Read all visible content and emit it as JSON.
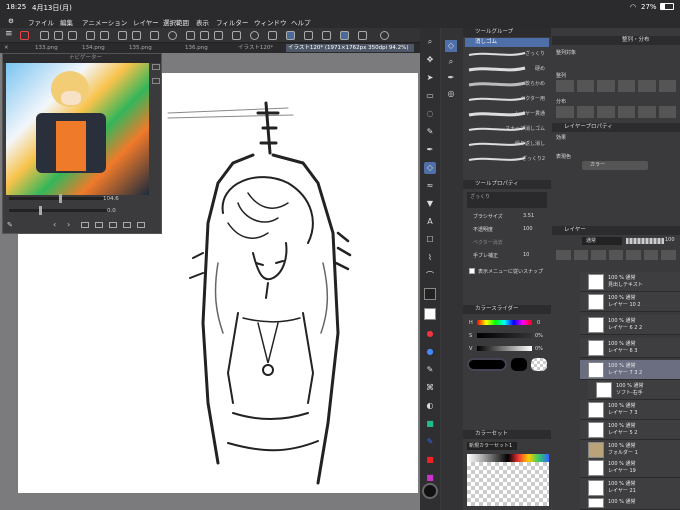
{
  "status": {
    "time": "18:25",
    "date": "4月13日(月)",
    "battery": "27%"
  },
  "menu": [
    "ファイル",
    "編集",
    "アニメーション",
    "レイヤー",
    "選択範囲",
    "表示",
    "フィルター",
    "ウィンドウ",
    "ヘルプ"
  ],
  "tabs": [
    "133.png",
    "134.png",
    "135.png",
    "136.png",
    "イラスト120*",
    "イラスト120* (1971×1762px 350dpi 94.2%)"
  ],
  "navigator": {
    "title": "ナビゲーター",
    "zoom": "104.6",
    "angle": "0.0"
  },
  "brushpanel": {
    "title": "ツールグループ",
    "active": "消しゴム",
    "brushes": [
      "ざっくり",
      "硬め",
      "軟らかめ",
      "ベクター用",
      "レイヤー貫通",
      "スナップ消しゴム",
      "繰り返し消し",
      "ざっくり2"
    ]
  },
  "toolprop": {
    "title": "ツールプロパティ",
    "tool": "ざっくり",
    "rows": [
      {
        "label": "ブラシサイズ",
        "value": "3.51"
      },
      {
        "label": "不透明度",
        "value": "100"
      },
      {
        "label": "ベクター消去",
        "value": ""
      },
      {
        "label": "手ブレ補正",
        "value": "10"
      }
    ],
    "checkbox": "表示メニューに従いスナップ"
  },
  "colorslider": {
    "title": "カラースライダー",
    "rows": [
      {
        "label": "H",
        "value": "0"
      },
      {
        "label": "S",
        "value": "0%"
      },
      {
        "label": "V",
        "value": "0%"
      }
    ]
  },
  "colorset": {
    "title": "カラーセット",
    "set": "新規カラーセット1"
  },
  "nav2": {
    "title": "整列・分布",
    "align_label": "整列対象",
    "sub1": "整列",
    "sub2": "分布"
  },
  "layerprop": {
    "title": "レイヤープロパティ",
    "effect": "効果",
    "expr": "表現色",
    "expr_value": "カラー"
  },
  "layers": {
    "title": "レイヤー",
    "blend": "通常",
    "opacity": "100",
    "items": [
      {
        "line1": "100 % 通常",
        "line2": "見出しテキスト"
      },
      {
        "line1": "100 % 通常",
        "line2": "レイヤー 10 2"
      },
      {
        "line1": "100 % 通常",
        "line2": "レイヤー 6 2 2"
      },
      {
        "line1": "100 % 通常",
        "line2": "レイヤー 6 3"
      },
      {
        "line1": "100 % 通常",
        "line2": "レイヤー 7 3 2"
      },
      {
        "line1": "100 % 通常",
        "line2": "ソフト-右手"
      },
      {
        "line1": "100 % 通常",
        "line2": "レイヤー 7 3"
      },
      {
        "line1": "100 % 通常",
        "line2": "レイヤー 5 2"
      },
      {
        "line1": "48 % 通常",
        "line2": "レイヤー 5 2"
      },
      {
        "line1": "100 % 通常",
        "line2": "フォルダー 1"
      },
      {
        "line1": "100 % 通常",
        "line2": "レイヤー 19"
      },
      {
        "line1": "100 % 通常",
        "line2": "レイヤー 21"
      },
      {
        "line1": "100 % 通常",
        "line2": "レイヤー 14"
      }
    ]
  }
}
